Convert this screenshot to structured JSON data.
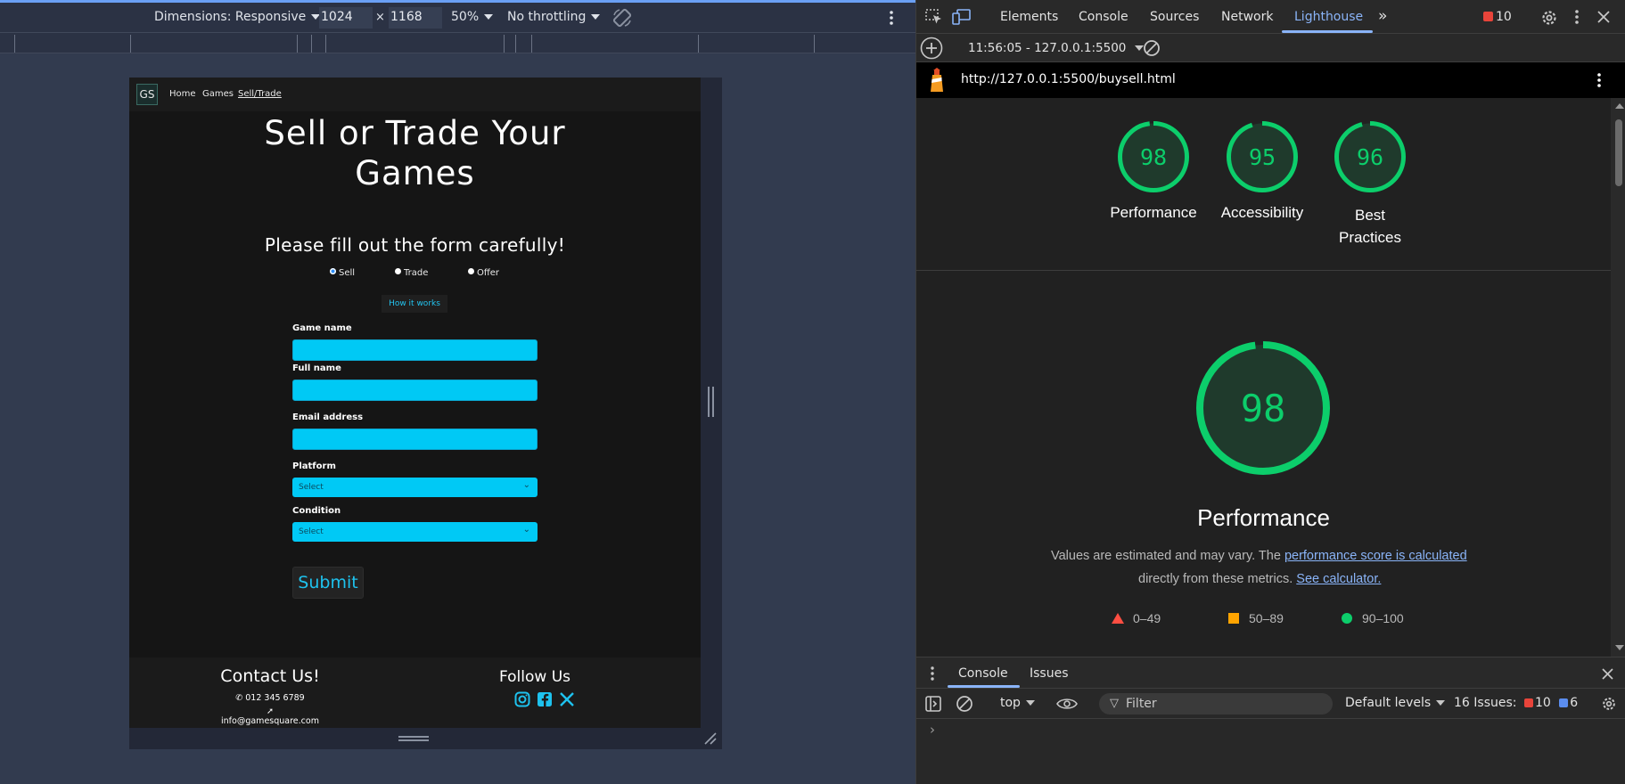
{
  "device_toolbar": {
    "dimensions_label": "Dimensions: Responsive",
    "width_value": "1024",
    "times_symbol": "×",
    "height_value": "1168",
    "zoom": "50%",
    "throttling": "No throttling"
  },
  "site": {
    "logo": "GS",
    "nav": [
      "Home",
      "Games",
      "Sell/Trade"
    ],
    "title": "Sell or Trade Your Games",
    "subtitle": "Please fill out the form carefully!",
    "radio_options": [
      {
        "label": "Sell",
        "selected": true
      },
      {
        "label": "Trade",
        "selected": false
      },
      {
        "label": "Offer",
        "selected": false
      }
    ],
    "how_button": "How it works",
    "fields": {
      "game_name": "Game name",
      "full_name": "Full name",
      "email": "Email address",
      "platform": "Platform",
      "condition": "Condition"
    },
    "platform_select": "Select",
    "condition_select": "Select",
    "submit": "Submit",
    "footer": {
      "contact_title": "Contact Us!",
      "phone": "012 345 6789",
      "email": "info@gamesquare.com",
      "follow_title": "Follow Us",
      "social_icons": [
        "instagram-icon",
        "facebook-icon",
        "x-icon"
      ]
    }
  },
  "devtools": {
    "tabs": [
      "Elements",
      "Console",
      "Sources",
      "Network",
      "Lighthouse"
    ],
    "active_tab": "Lighthouse",
    "error_count": "10",
    "report_selector": "11:56:05 - 127.0.0.1:5500",
    "url": "http://127.0.0.1:5500/buysell.html",
    "scores": [
      {
        "label": "Performance",
        "value": "98"
      },
      {
        "label": "Accessibility",
        "value": "95"
      },
      {
        "label": "Best Practices",
        "value": "96"
      }
    ],
    "main_score": {
      "value": "98",
      "title": "Performance"
    },
    "desc_line1": "Values are estimated and may vary. The",
    "desc_link1": "performance score is calculated",
    "desc_line2": "directly from these metrics.",
    "desc_link2": "See calculator.",
    "legend": [
      "0–49",
      "50–89",
      "90–100"
    ],
    "colors": {
      "pass": "#0cce6b",
      "average": "#ffa400",
      "fail": "#ff4e42",
      "accent": "#8ab4f8"
    }
  },
  "drawer": {
    "tabs": [
      "Console",
      "Issues"
    ],
    "active_tab": "Console",
    "context": "top",
    "filter_placeholder": "Filter",
    "levels": "Default levels",
    "issues_label": "16 Issues:",
    "issues_errors": "10",
    "issues_info": "6"
  }
}
